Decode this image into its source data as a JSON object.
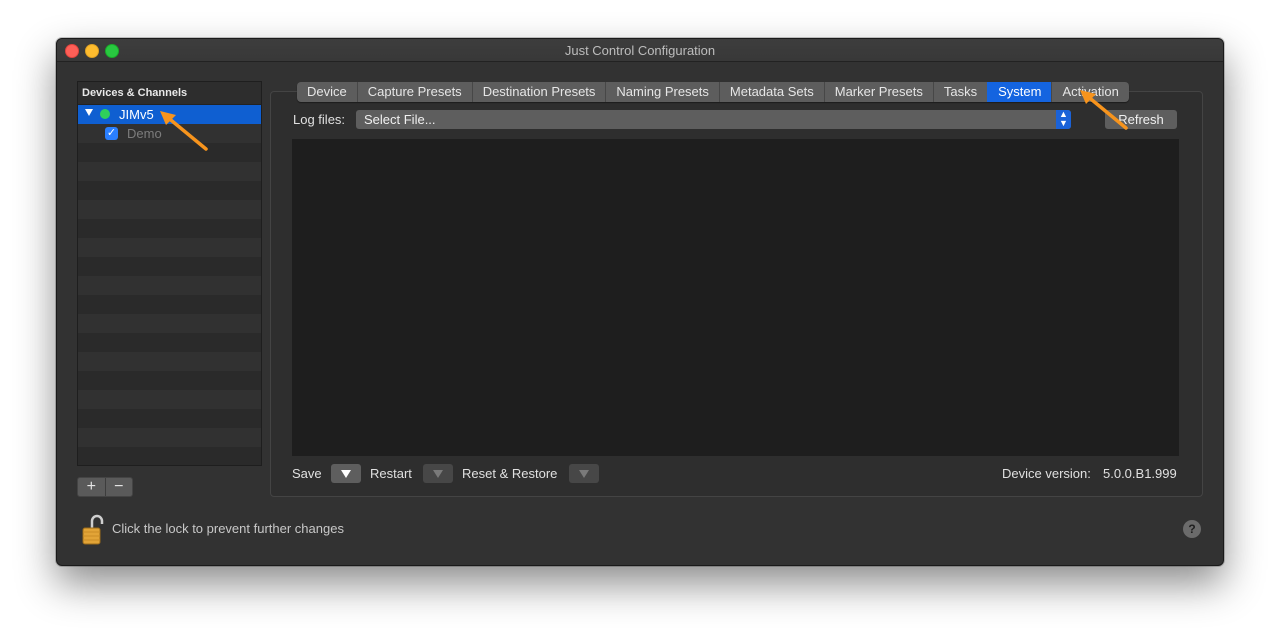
{
  "window": {
    "title": "Just Control Configuration"
  },
  "sidebar": {
    "header": "Devices & Channels",
    "device": {
      "label": "JIMv5",
      "status_color": "#2fd15a",
      "expanded": true,
      "selected": true
    },
    "channel": {
      "label": "Demo",
      "checked": true
    },
    "add_label": "+",
    "remove_label": "−"
  },
  "tabs": [
    {
      "label": "Device",
      "active": false
    },
    {
      "label": "Capture Presets",
      "active": false
    },
    {
      "label": "Destination Presets",
      "active": false
    },
    {
      "label": "Naming Presets",
      "active": false
    },
    {
      "label": "Metadata Sets",
      "active": false
    },
    {
      "label": "Marker Presets",
      "active": false
    },
    {
      "label": "Tasks",
      "active": false
    },
    {
      "label": "System",
      "active": true
    },
    {
      "label": "Activation",
      "active": false
    }
  ],
  "system": {
    "log_files_label": "Log files:",
    "log_select_value": "Select File...",
    "refresh_label": "Refresh",
    "save_label": "Save",
    "restart_label": "Restart",
    "reset_restore_label": "Reset & Restore",
    "device_version_label": "Device version:",
    "device_version_value": "5.0.0.B1.999"
  },
  "footer": {
    "lock_text": "Click the lock to prevent further changes",
    "help_label": "?"
  },
  "colors": {
    "accent": "#1464e0",
    "annotation_arrow": "#f7941d"
  }
}
